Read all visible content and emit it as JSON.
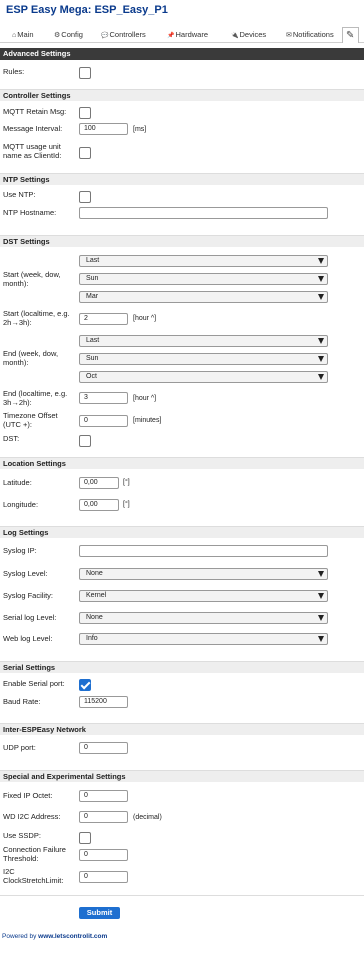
{
  "app_title": "ESP Easy Mega: ESP_Easy_P1",
  "tabs": [
    {
      "label": "Main",
      "icon": "home-icon",
      "glyph": "⌂"
    },
    {
      "label": "Config",
      "icon": "gear-icon",
      "glyph": "⚙"
    },
    {
      "label": "Controllers",
      "icon": "chat-icon",
      "glyph": "💬"
    },
    {
      "label": "Hardware",
      "icon": "pin-icon",
      "glyph": "📌"
    },
    {
      "label": "Devices",
      "icon": "plug-icon",
      "glyph": "🔌"
    },
    {
      "label": "Notifications",
      "icon": "mail-icon",
      "glyph": "✉"
    },
    {
      "label": "",
      "icon": "pencil-icon",
      "glyph": "✎"
    }
  ],
  "sections": {
    "advanced": "Advanced Settings",
    "controller": "Controller Settings",
    "ntp": "NTP Settings",
    "dst": "DST Settings",
    "location": "Location Settings",
    "log": "Log Settings",
    "serial": "Serial Settings",
    "inter": "Inter-ESPEasy Network",
    "special": "Special and Experimental Settings"
  },
  "fields": {
    "rules": {
      "label": "Rules:",
      "checked": false
    },
    "mqtt_retain": {
      "label": "MQTT Retain Msg:",
      "checked": false
    },
    "message_interval": {
      "label": "Message Interval:",
      "value": "100",
      "unit": "[ms]"
    },
    "mqtt_unit_name": {
      "label": "MQTT usage unit name as ClientId:",
      "checked": false
    },
    "use_ntp": {
      "label": "Use NTP:",
      "checked": false
    },
    "ntp_hostname": {
      "label": "NTP Hostname:",
      "value": ""
    },
    "dst_start": {
      "label": "Start (week, dow, month):",
      "week": "Last",
      "dow": "Sun",
      "month": "Mar"
    },
    "dst_start_time": {
      "label": "Start (localtime, e.g. 2h→3h):",
      "value": "2",
      "unit": "[hour ^]"
    },
    "dst_end": {
      "label": "End (week, dow, month):",
      "week": "Last",
      "dow": "Sun",
      "month": "Oct"
    },
    "dst_end_time": {
      "label": "End (localtime, e.g. 3h→2h):",
      "value": "3",
      "unit": "[hour ^]"
    },
    "tz_offset": {
      "label": "Timezone Offset (UTC +):",
      "value": "0",
      "unit": "[minutes]"
    },
    "dst": {
      "label": "DST:",
      "checked": false
    },
    "latitude": {
      "label": "Latitude:",
      "value": "0,00",
      "unit": "[°]"
    },
    "longitude": {
      "label": "Longitude:",
      "value": "0,00",
      "unit": "[°]"
    },
    "syslog_ip": {
      "label": "Syslog IP:",
      "value": ""
    },
    "syslog_level": {
      "label": "Syslog Level:",
      "value": "None"
    },
    "syslog_facility": {
      "label": "Syslog Facility:",
      "value": "Kernel"
    },
    "serial_log_level": {
      "label": "Serial log Level:",
      "value": "None"
    },
    "web_log_level": {
      "label": "Web log Level:",
      "value": "Info"
    },
    "enable_serial": {
      "label": "Enable Serial port:",
      "checked": true
    },
    "baud_rate": {
      "label": "Baud Rate:",
      "value": "115200"
    },
    "udp_port": {
      "label": "UDP port:",
      "value": "0"
    },
    "fixed_ip_octet": {
      "label": "Fixed IP Octet:",
      "value": "0"
    },
    "wd_i2c": {
      "label": "WD I2C Address:",
      "value": "0",
      "unit": "(decimal)"
    },
    "use_ssdp": {
      "label": "Use SSDP:",
      "checked": false
    },
    "conn_fail": {
      "label": "Connection Failure Threshold:",
      "value": "0"
    },
    "i2c_stretch": {
      "label": "I2C ClockStretchLimit:",
      "value": "0"
    }
  },
  "submit_label": "Submit",
  "footer": {
    "prefix": "Powered by ",
    "link": "www.letscontrolit.com"
  },
  "colors": {
    "title": "#0a3a8c",
    "header_dark": "#3a3a3a",
    "accent": "#1e6fd0"
  }
}
